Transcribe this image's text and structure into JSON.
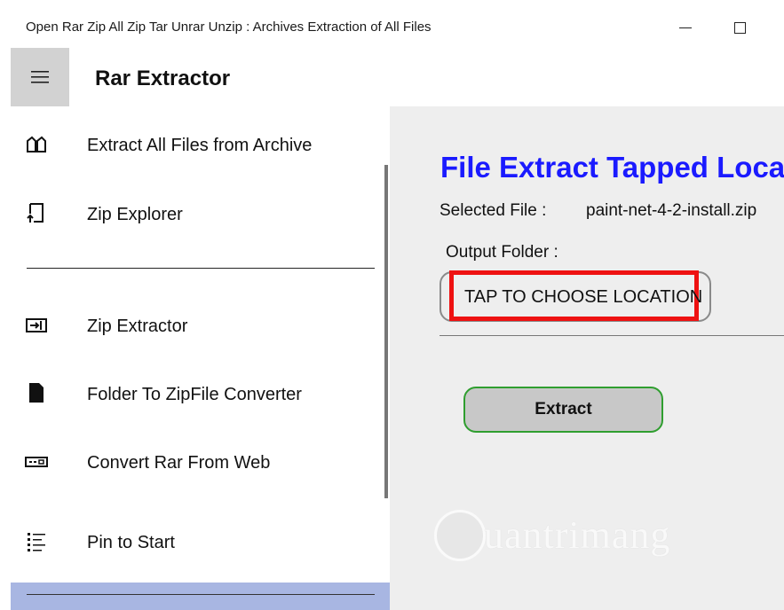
{
  "window": {
    "title": "Open Rar Zip All Zip Tar Unrar Unzip : Archives Extraction of All Files"
  },
  "app": {
    "title": "Rar Extractor"
  },
  "sidebar": {
    "items": [
      {
        "label": "Extract All Files from  Archive",
        "icon": "open-book-icon"
      },
      {
        "label": "Zip Explorer",
        "icon": "upload-frame-icon"
      },
      {
        "label": "Zip Extractor",
        "icon": "extract-arrow-icon"
      },
      {
        "label": "Folder To ZipFile Converter",
        "icon": "zip-file-icon"
      },
      {
        "label": "Convert Rar From Web",
        "icon": "web-dashes-icon"
      },
      {
        "label": "Pin to Start",
        "icon": "list-icon"
      }
    ],
    "selected_color": "#a8b6e2"
  },
  "main": {
    "heading": "File Extract Tapped Locat",
    "heading_color": "#1a1aff",
    "selected_file_label": "Selected File :",
    "selected_file_value": "paint-net-4-2-install.zip",
    "output_folder_label": "Output Folder :",
    "choose_location_label": "TAP TO CHOOSE LOCATION",
    "highlight_color": "#ee1111",
    "extract_label": "Extract",
    "extract_border_color": "#2f9e2f"
  },
  "watermark": {
    "text": "uantrimang"
  }
}
